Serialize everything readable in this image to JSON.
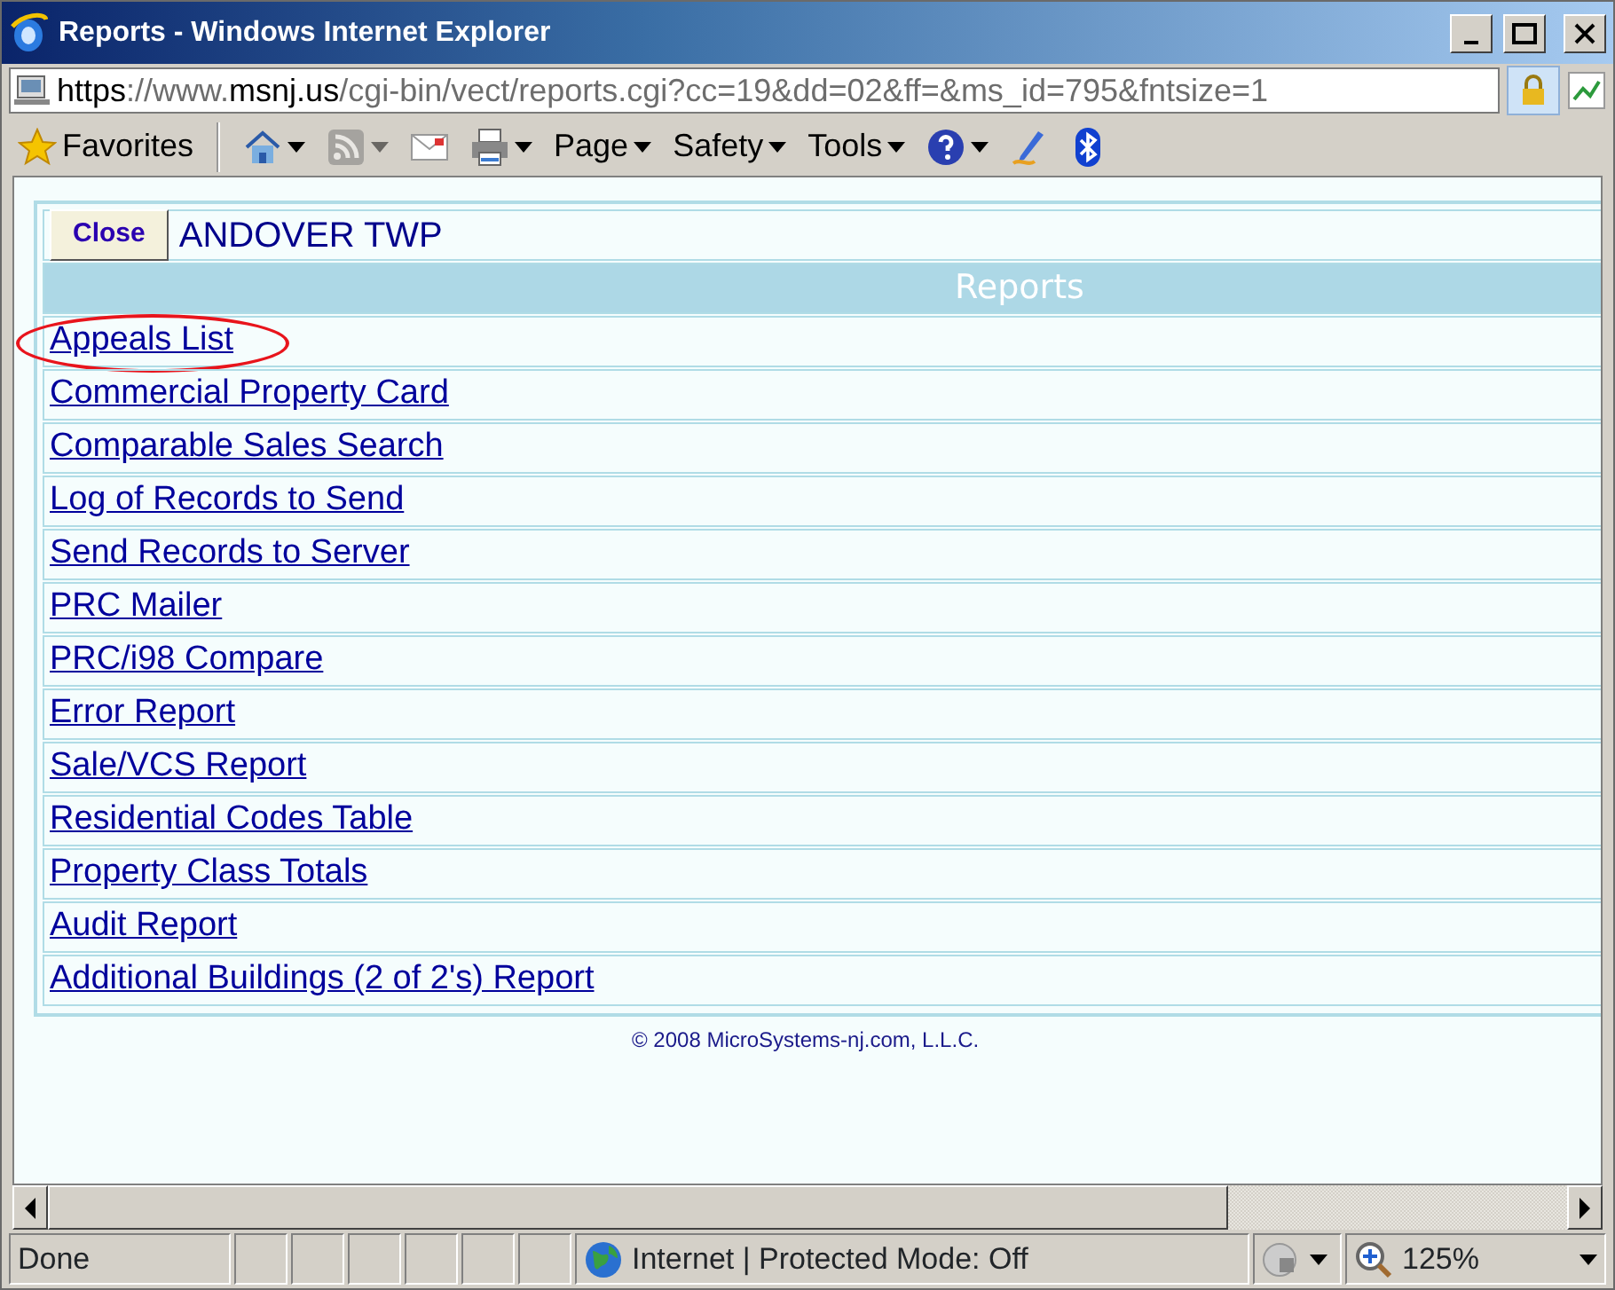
{
  "window": {
    "title": "Reports - Windows Internet Explorer"
  },
  "address_bar": {
    "url_parts": [
      {
        "text": "https",
        "strong": true
      },
      {
        "text": "://www.",
        "strong": false
      },
      {
        "text": "msnj.us",
        "strong": true
      },
      {
        "text": "/cgi-bin/vect/reports.cgi?cc=19&dd=02&ff=&ms_id=795&fntsize=1",
        "strong": false
      }
    ]
  },
  "toolbar": {
    "favorites": "Favorites",
    "items": [
      {
        "kind": "home",
        "dropdown": true,
        "disabled": false
      },
      {
        "kind": "feeds",
        "dropdown": true,
        "disabled": true
      },
      {
        "kind": "mail",
        "dropdown": false,
        "disabled": false
      },
      {
        "kind": "print",
        "dropdown": true,
        "disabled": false
      },
      {
        "kind": "menu",
        "label": "Page",
        "dropdown": true,
        "disabled": false
      },
      {
        "kind": "menu",
        "label": "Safety",
        "dropdown": true,
        "disabled": false
      },
      {
        "kind": "menu",
        "label": "Tools",
        "dropdown": true,
        "disabled": false
      },
      {
        "kind": "help",
        "dropdown": true,
        "disabled": false
      },
      {
        "kind": "pen",
        "dropdown": false,
        "disabled": false
      },
      {
        "kind": "bluetooth",
        "dropdown": false,
        "disabled": false
      }
    ]
  },
  "page": {
    "close_button": "Close",
    "township": "ANDOVER TWP",
    "header": "Reports",
    "reports": [
      {
        "label": "Appeals List",
        "circled": true
      },
      {
        "label": "Commercial Property Card",
        "circled": false
      },
      {
        "label": "Comparable Sales Search",
        "circled": false
      },
      {
        "label": "Log of Records to Send",
        "circled": false
      },
      {
        "label": "Send Records to Server",
        "circled": false
      },
      {
        "label": "PRC Mailer",
        "circled": false
      },
      {
        "label": "PRC/i98 Compare",
        "circled": false
      },
      {
        "label": "Error Report",
        "circled": false
      },
      {
        "label": "Sale/VCS Report",
        "circled": false
      },
      {
        "label": "Residential Codes Table",
        "circled": false
      },
      {
        "label": "Property Class Totals",
        "circled": false
      },
      {
        "label": "Audit Report",
        "circled": false
      },
      {
        "label": "Additional Buildings (2 of 2's) Report",
        "circled": false
      }
    ],
    "footer": "© 2008 MicroSystems-nj.com, L.L.C."
  },
  "status_bar": {
    "text": "Done",
    "zone": "Internet | Protected Mode: Off",
    "zoom": "125%"
  }
}
